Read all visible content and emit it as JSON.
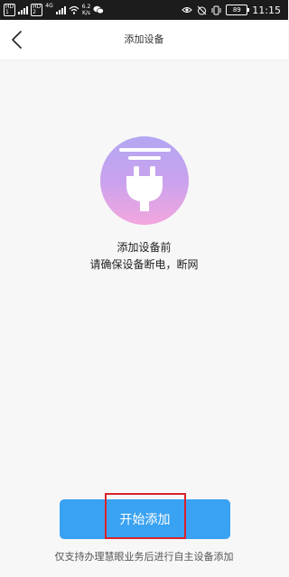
{
  "status_bar": {
    "hd1": "HD",
    "hd2": "HD",
    "network": "4G",
    "speed_value": "6.2",
    "speed_unit": "K/s",
    "battery": "89",
    "time": "11:15"
  },
  "header": {
    "title": "添加设备"
  },
  "notice": {
    "line1": "添加设备前",
    "line2": "请确保设备断电，断网"
  },
  "actions": {
    "start_label": "开始添加"
  },
  "footer": {
    "note": "仅支持办理慧眼业务后进行自主设备添加"
  },
  "colors": {
    "accent": "#3aa2f2",
    "highlight": "#d9232a"
  }
}
